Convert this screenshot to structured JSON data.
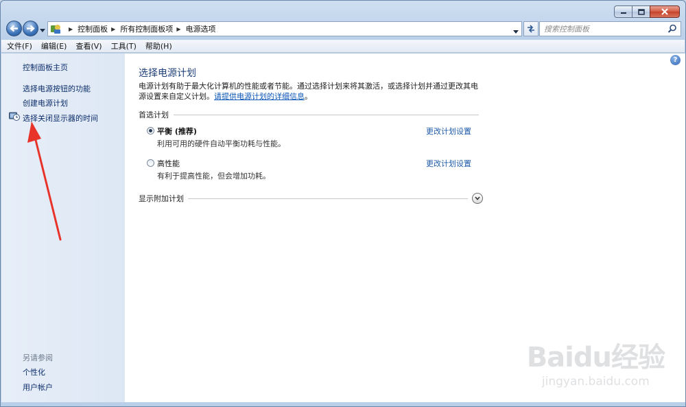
{
  "window": {
    "controls": {
      "minimize": "minimize",
      "maximize": "maximize",
      "close": "close"
    }
  },
  "address_bar": {
    "breadcrumbs": [
      "控制面板",
      "所有控制面板项",
      "电源选项"
    ],
    "search_placeholder": "搜索控制面板"
  },
  "menu": [
    "文件(F)",
    "编辑(E)",
    "查看(V)",
    "工具(T)",
    "帮助(H)"
  ],
  "sidebar": {
    "home": "控制面板主页",
    "tasks": [
      "选择电源按钮的功能",
      "创建电源计划",
      "选择关闭显示器的时间"
    ],
    "see_also_heading": "另请参阅",
    "see_also": [
      "个性化",
      "用户帐户"
    ]
  },
  "main": {
    "title": "选择电源计划",
    "description_prefix": "电源计划有助于最大化计算机的性能或者节能。通过选择计划来将其激活，或选择计划并通过更改其电源设置来自定义计划。",
    "description_link": "请提供电源计划的详细信息",
    "description_suffix": "。",
    "preferred_heading": "首选计划",
    "plans": [
      {
        "name": "平衡 (推荐)",
        "desc": "利用可用的硬件自动平衡功耗与性能。",
        "link": "更改计划设置",
        "selected": true
      },
      {
        "name": "高性能",
        "desc": "有利于提高性能，但会增加功耗。",
        "link": "更改计划设置",
        "selected": false
      }
    ],
    "show_more": "显示附加计划"
  },
  "watermark": {
    "logo": "Baidu经验",
    "url": "jingyan.baidu.com"
  },
  "icons": {
    "back": "back-arrow-icon",
    "forward": "forward-arrow-icon",
    "control_panel": "control-panel-icon",
    "refresh": "refresh-icon",
    "search": "search-icon",
    "help": "help-icon",
    "display_clock": "display-clock-icon",
    "expand": "chevron-down-icon"
  },
  "colors": {
    "accent": "#1d5aaa",
    "annotation_arrow": "#e8332a"
  }
}
